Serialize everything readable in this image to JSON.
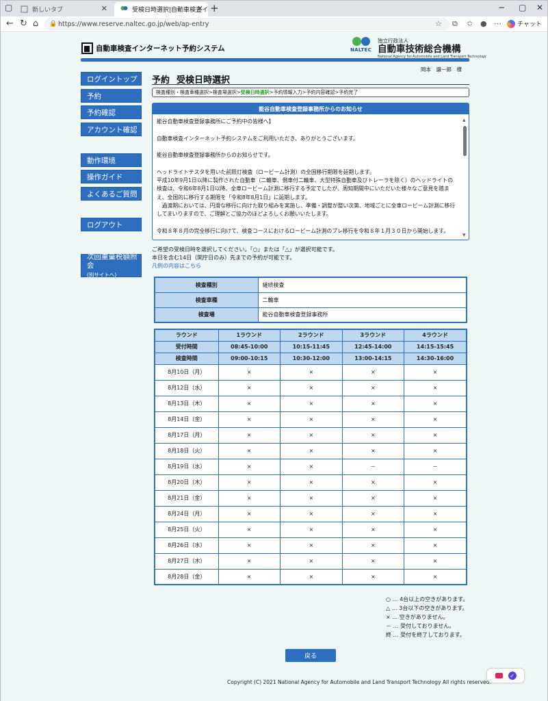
{
  "browser": {
    "tabs": [
      {
        "title": "新しいタブ",
        "active": false
      },
      {
        "title": "受検日時選択|自動車検査インターネッ",
        "active": true
      }
    ],
    "url": "https://www.reserve.naltec.go.jp/web/ap-entry",
    "copilot_label": "チャット"
  },
  "header": {
    "system_title": "自動車検査インターネット予約システム",
    "org_small": "独立行政法人",
    "org_name": "自動車技術総合機構",
    "org_en": "National Agency for Automobile and Land Transport Technology",
    "org_abbr": "NALTEC",
    "user_name": "岡本　譲一郎　様"
  },
  "sidebar": {
    "items": [
      "ログイントップ",
      "予約",
      "予約確認",
      "アカウント確認",
      "動作環境",
      "操作ガイド",
      "よくあるご質問",
      "ログアウト"
    ],
    "external_label": "次回重量税額照会",
    "external_sub": "(別サイトへ)"
  },
  "main": {
    "title_a": "予約",
    "title_b": "受検日時選択",
    "breadcrumb": {
      "step1": "検査種別・検査車種選択",
      "step2": "検査場選択",
      "step3": "受検日時選択",
      "step4": "予約情報入力",
      "step5": "予約内容確認",
      "step6": "予約完了",
      "sep": " > "
    },
    "notice": {
      "heading": "能谷自動車検査登録事務所からのお知らせ",
      "lines": [
        "能谷自動車検査登録事務所にご予約中の皆様へ】",
        "",
        "自動車検査インターネット予約システムをご利用いただき、ありがとうございます。",
        "",
        "能谷自動車検査登録事務所からのお知らせです。",
        "",
        "ヘッドライトテスタを用いた前照灯検査（ロービーム計測）の全国移行期限を延期します。",
        "平成10年9月1日以降に製作された自動車（二輪車、側車付二輪車、大型特殊自動車及びトレーラを除く）のヘッドライトの",
        "検査は、令和6年8月1日以降、全車ロービーム計測に移行する予定でしたが、周知期間中にいただいた様々なご意見を踏ま",
        "え、全国的に移行する期限を「令和8年8月1日」に延期します。",
        "　過渡期においては、円滑な移行に向けた取り組みを実施し、準備・調整が整い次第、地域ごとに全車ロービーム計測に移行",
        "してまいりますので、ご理解とご協力のほどよろしくお願いいたします。",
        "",
        "令和８年８月の完全移行に向けて、検査コースにおけるロービーム計測のプレ移行を令和８年１月３０日から開始します。"
      ]
    },
    "instructions": {
      "line1": "ご希望の受検日時を選択してください。「○」または「△」が選択可能です。",
      "line2": "本日を含む14日（閑庁日のみ）先までの予約が可能です。",
      "legend_link": "凡例の内容はこちら"
    },
    "info": [
      {
        "label": "検査種別",
        "value": "継続検査"
      },
      {
        "label": "検査車種",
        "value": "二輪車"
      },
      {
        "label": "検査場",
        "value": "能谷自動車検査登録事務所"
      }
    ],
    "schedule": {
      "round_label": "ラウンド",
      "reception_label": "受付時間",
      "inspection_label": "検査時間",
      "rounds": [
        "1ラウンド",
        "2ラウンド",
        "3ラウンド",
        "4ラウンド"
      ],
      "reception": [
        "08:45-10:00",
        "10:15-11:45",
        "12:45-14:00",
        "14:15-15:45"
      ],
      "inspection": [
        "09:00-10:15",
        "10:30-12:00",
        "13:00-14:15",
        "14:30-16:00"
      ],
      "rows": [
        {
          "date": "8月10日（月）",
          "slots": [
            "×",
            "×",
            "×",
            "×"
          ]
        },
        {
          "date": "8月12日（水）",
          "slots": [
            "×",
            "×",
            "×",
            "×"
          ]
        },
        {
          "date": "8月13日（木）",
          "slots": [
            "×",
            "×",
            "×",
            "×"
          ]
        },
        {
          "date": "8月14日（金）",
          "slots": [
            "×",
            "×",
            "×",
            "×"
          ]
        },
        {
          "date": "8月17日（月）",
          "slots": [
            "×",
            "×",
            "×",
            "×"
          ]
        },
        {
          "date": "8月18日（火）",
          "slots": [
            "×",
            "×",
            "×",
            "×"
          ]
        },
        {
          "date": "8月19日（水）",
          "slots": [
            "×",
            "×",
            "－",
            "－"
          ]
        },
        {
          "date": "8月20日（木）",
          "slots": [
            "×",
            "×",
            "×",
            "×"
          ]
        },
        {
          "date": "8月21日（金）",
          "slots": [
            "×",
            "×",
            "×",
            "×"
          ]
        },
        {
          "date": "8月24日（月）",
          "slots": [
            "×",
            "×",
            "×",
            "×"
          ]
        },
        {
          "date": "8月25日（火）",
          "slots": [
            "×",
            "×",
            "×",
            "×"
          ]
        },
        {
          "date": "8月26日（水）",
          "slots": [
            "×",
            "×",
            "×",
            "×"
          ]
        },
        {
          "date": "8月27日（木）",
          "slots": [
            "×",
            "×",
            "×",
            "×"
          ]
        },
        {
          "date": "8月28日（金）",
          "slots": [
            "×",
            "×",
            "×",
            "×"
          ]
        }
      ]
    },
    "legend": [
      "○ … 4台以上の空きがあります。",
      "△ … 3台以下の空きがあります。",
      "× … 空きがありません。",
      "－ … 受付しておりません。",
      "終 … 受付を終了しております。"
    ],
    "back_label": "戻る"
  },
  "footer": {
    "copyright": "Copyright (C) 2021 National Agency for Automobile and Land Transport Technology All rights reserved."
  },
  "colors": {
    "accent": "#2d6ebe",
    "header_cell": "#bed8ef",
    "page_bg": "#eef6f6",
    "current_step": "#2a9a2a"
  }
}
